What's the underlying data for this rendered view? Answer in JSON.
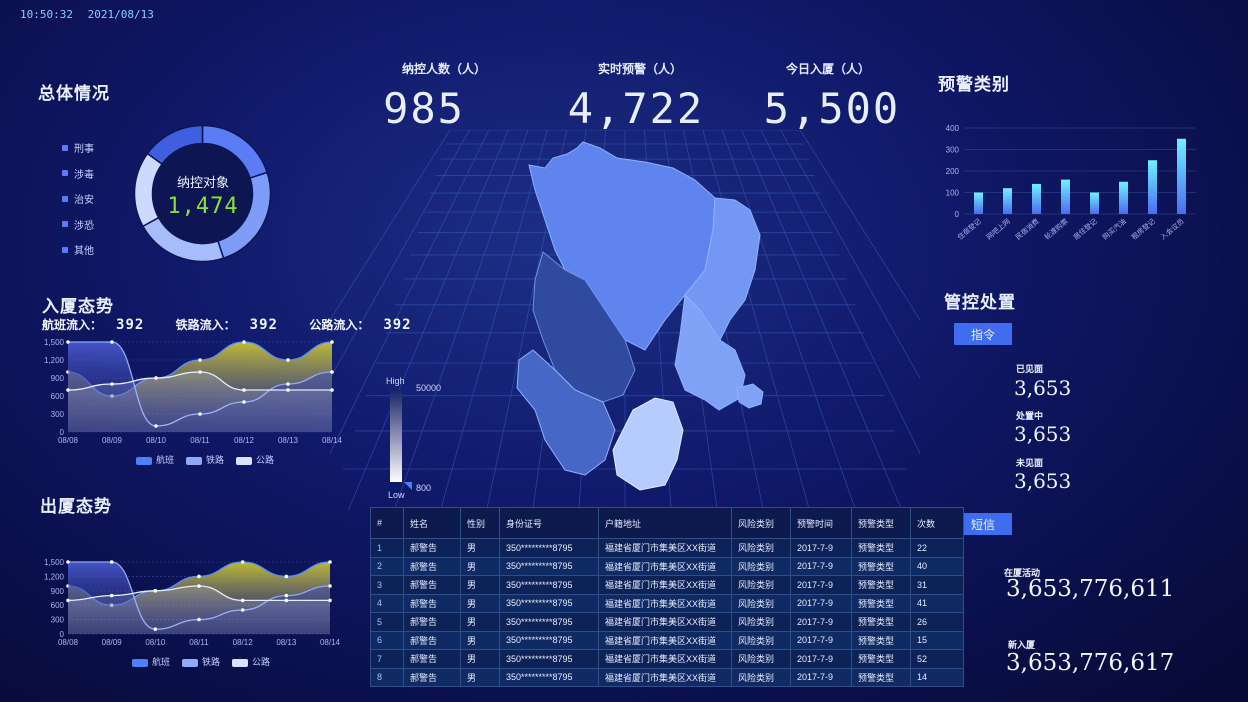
{
  "header": {
    "time": "10:50:32",
    "date": "2021/08/13"
  },
  "overall": {
    "title": "总体情况",
    "legend": [
      "刑事",
      "涉毒",
      "治安",
      "涉恐",
      "其他"
    ],
    "donut_label": "纳控对象",
    "donut_value": "1,474",
    "colors": [
      "#5b7cf5",
      "#7f9cf8",
      "#a7bdfb",
      "#cdd9ff",
      "#3f5fe0"
    ]
  },
  "kpis": [
    {
      "label": "纳控人数（人）",
      "value": "985"
    },
    {
      "label": "实时预警（人）",
      "value": "4,722"
    },
    {
      "label": "今日入厦（人）",
      "value": "5,500"
    }
  ],
  "inflow": {
    "title": "入厦态势",
    "stats": [
      {
        "label": "航班流入：",
        "value": "392"
      },
      {
        "label": "铁路流入：",
        "value": "392"
      },
      {
        "label": "公路流入：",
        "value": "392"
      }
    ],
    "legend": [
      "航班",
      "铁路",
      "公路"
    ],
    "chart_data": {
      "type": "area",
      "x": [
        "08/08",
        "08/09",
        "08/10",
        "08/11",
        "08/12",
        "08/13",
        "08/14"
      ],
      "yticks": [
        "0",
        "300",
        "600",
        "900",
        "1,200",
        "1,500"
      ],
      "ylim": [
        0,
        1500
      ],
      "series": [
        {
          "name": "航班",
          "values": [
            1000,
            600,
            900,
            1200,
            1500,
            1200,
            1500
          ]
        },
        {
          "name": "铁路",
          "values": [
            1500,
            1500,
            100,
            300,
            500,
            800,
            1000
          ]
        },
        {
          "name": "公路",
          "values": [
            700,
            800,
            900,
            1000,
            700,
            700,
            700
          ]
        }
      ]
    }
  },
  "outflow": {
    "title": "出厦态势",
    "legend": [
      "航班",
      "铁路",
      "公路"
    ],
    "chart_data": {
      "type": "area",
      "x": [
        "08/08",
        "08/09",
        "08/10",
        "08/11",
        "08/12",
        "08/13",
        "08/14"
      ],
      "yticks": [
        "0",
        "300",
        "600",
        "900",
        "1,200",
        "1,500"
      ],
      "ylim": [
        0,
        1500
      ],
      "series": [
        {
          "name": "航班",
          "values": [
            1000,
            600,
            900,
            1200,
            1500,
            1200,
            1500
          ]
        },
        {
          "name": "铁路",
          "values": [
            1500,
            1500,
            100,
            300,
            500,
            800,
            1000
          ]
        },
        {
          "name": "公路",
          "values": [
            700,
            800,
            900,
            1000,
            700,
            700,
            700
          ]
        }
      ]
    }
  },
  "map_legend": {
    "high": "High",
    "low": "Low",
    "max": "50000",
    "min": "800"
  },
  "warning": {
    "title": "预警类别",
    "chart_data": {
      "type": "bar",
      "categories": [
        "住宿登记",
        "网吧上网",
        "民宿消费",
        "轮渡购票",
        "居住登记",
        "购买汽油",
        "租房登记",
        "入会议员"
      ],
      "values": [
        100,
        120,
        140,
        160,
        100,
        150,
        250,
        350
      ],
      "yticks": [
        "0",
        "100",
        "200",
        "300",
        "400"
      ],
      "ylim": [
        0,
        400
      ]
    }
  },
  "control": {
    "title": "管控处置",
    "order_btn": "指令",
    "sms_btn": "短信",
    "stats": [
      {
        "label": "已见面",
        "value": "3,653"
      },
      {
        "label": "处置中",
        "value": "3,653"
      },
      {
        "label": "未见面",
        "value": "3,653"
      }
    ],
    "big_stats": [
      {
        "label": "在厦活动",
        "value": "3,653,776,611"
      },
      {
        "label": "新入厦",
        "value": "3,653,776,617"
      }
    ]
  },
  "table": {
    "headers": [
      "#",
      "姓名",
      "性别",
      "身份证号",
      "户籍地址",
      "风险类别",
      "预警时间",
      "预警类型",
      "次数"
    ],
    "rows": [
      [
        "1",
        "郝警告",
        "男",
        "350*********8795",
        "福建省厦门市集美区XX街道",
        "风险类别",
        "2017-7-9",
        "预警类型",
        "22"
      ],
      [
        "2",
        "郝警告",
        "男",
        "350*********8795",
        "福建省厦门市集美区XX街道",
        "风险类别",
        "2017-7-9",
        "预警类型",
        "40"
      ],
      [
        "3",
        "郝警告",
        "男",
        "350*********8795",
        "福建省厦门市集美区XX街道",
        "风险类别",
        "2017-7-9",
        "预警类型",
        "31"
      ],
      [
        "4",
        "郝警告",
        "男",
        "350*********8795",
        "福建省厦门市集美区XX街道",
        "风险类别",
        "2017-7-9",
        "预警类型",
        "41"
      ],
      [
        "5",
        "郝警告",
        "男",
        "350*********8795",
        "福建省厦门市集美区XX街道",
        "风险类别",
        "2017-7-9",
        "预警类型",
        "26"
      ],
      [
        "6",
        "郝警告",
        "男",
        "350*********8795",
        "福建省厦门市集美区XX街道",
        "风险类别",
        "2017-7-9",
        "预警类型",
        "15"
      ],
      [
        "7",
        "郝警告",
        "男",
        "350*********8795",
        "福建省厦门市集美区XX街道",
        "风险类别",
        "2017-7-9",
        "预警类型",
        "52"
      ],
      [
        "8",
        "郝警告",
        "男",
        "350*********8795",
        "福建省厦门市集美区XX街道",
        "风险类别",
        "2017-7-9",
        "预警类型",
        "14"
      ]
    ]
  }
}
